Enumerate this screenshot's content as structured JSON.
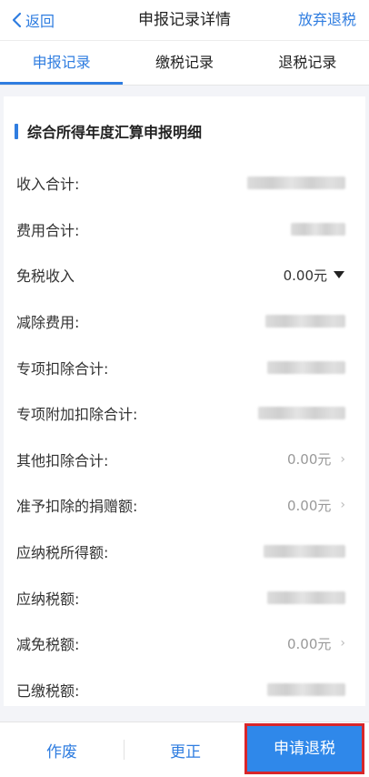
{
  "nav": {
    "back_label": "返回",
    "title": "申报记录详情",
    "right_action": "放弃退税"
  },
  "tabs": [
    {
      "label": "申报记录",
      "active": true
    },
    {
      "label": "缴税记录",
      "active": false
    },
    {
      "label": "退税记录",
      "active": false
    }
  ],
  "section": {
    "title": "综合所得年度汇算申报明细"
  },
  "rows": [
    {
      "label": "收入合计:",
      "value": ""
    },
    {
      "label": "费用合计:",
      "value": ""
    },
    {
      "label": "免税收入",
      "value": "0.00元"
    },
    {
      "label": "减除费用:",
      "value": ""
    },
    {
      "label": "专项扣除合计:",
      "value": ""
    },
    {
      "label": "专项附加扣除合计:",
      "value": ""
    },
    {
      "label": "其他扣除合计:",
      "value": "0.00元"
    },
    {
      "label": "准予扣除的捐赠额:",
      "value": "0.00元"
    },
    {
      "label": "应纳税所得额:",
      "value": ""
    },
    {
      "label": "应纳税额:",
      "value": ""
    },
    {
      "label": "减免税额:",
      "value": "0.00元"
    },
    {
      "label": "已缴税额:",
      "value": ""
    }
  ],
  "footer": {
    "void_label": "作废",
    "correct_label": "更正",
    "apply_label": "申请退税"
  },
  "colors": {
    "accent": "#2f7de0",
    "highlight_border": "#d8262a"
  }
}
